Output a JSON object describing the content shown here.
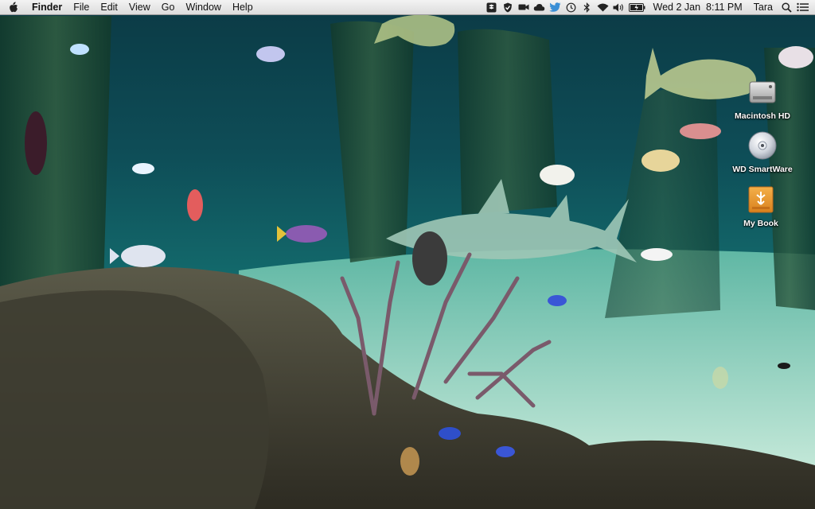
{
  "menubar": {
    "apple_icon": "apple-icon",
    "app_name": "Finder",
    "menus": [
      "File",
      "Edit",
      "View",
      "Go",
      "Window",
      "Help"
    ],
    "status_icons": [
      "dropbox-icon",
      "shield-icon",
      "camera-icon",
      "cloud-icon",
      "twitter-bird-icon",
      "time-machine-icon",
      "bluetooth-icon",
      "wifi-icon",
      "volume-icon",
      "battery-icon"
    ],
    "date": "Wed 2 Jan",
    "time": "8:11 PM",
    "user": "Tara",
    "search_icon": "spotlight-search-icon",
    "notifications_icon": "notification-center-icon"
  },
  "desktop_icons": [
    {
      "label": "Macintosh HD",
      "icon": "hard-drive-icon"
    },
    {
      "label": "WD SmartWare",
      "icon": "cd-disc-icon"
    },
    {
      "label": "My Book",
      "icon": "usb-drive-icon"
    }
  ],
  "colors": {
    "menubar_bg": "#e6e6e6",
    "water_dark": "#0b3a45",
    "water_light": "#1a6c6a",
    "sand": "#bfe6d2",
    "usb_folder": "#e89a2c"
  }
}
